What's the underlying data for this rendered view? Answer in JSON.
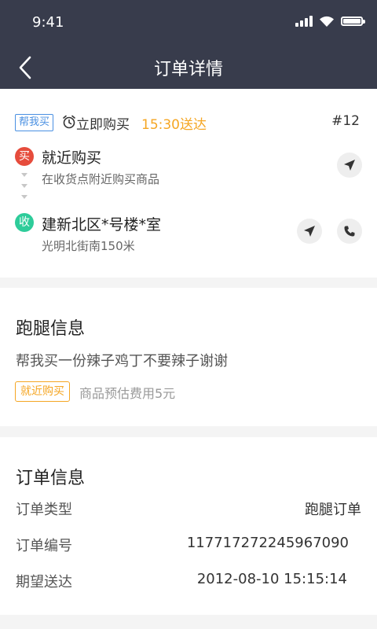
{
  "status_bar": {
    "time": "9:41",
    "icons": [
      "signal-icon",
      "wifi-icon",
      "battery-icon"
    ]
  },
  "nav": {
    "title": "订单详情",
    "back_icon": "chevron-left-icon"
  },
  "order": {
    "tag": "帮我买",
    "mode": "立即购买",
    "deliver_time": "15:30送达",
    "number": "#12",
    "pickup": {
      "badge": "买",
      "title": "就近购买",
      "subtitle": "在收货点附近购买商品"
    },
    "dropoff": {
      "badge": "收",
      "title": "建新北区*号楼*室",
      "subtitle": "光明北街南150米"
    }
  },
  "errand": {
    "title": "跑腿信息",
    "description": "帮我买一份辣子鸡丁不要辣子谢谢",
    "tag": "就近购买",
    "fee": "商品预估费用5元"
  },
  "order_info": {
    "title": "订单信息",
    "rows": [
      {
        "label": "订单类型",
        "value": "跑腿订单"
      },
      {
        "label": "订单编号",
        "value": "117717272245967090"
      },
      {
        "label": "期望送达",
        "value": "2012-08-10 15:15:14"
      }
    ]
  },
  "colors": {
    "header": "#383c4c",
    "accent_orange": "#f5a623",
    "blue": "#4a90e2",
    "red": "#e64c3c",
    "green": "#2ecc9a"
  }
}
